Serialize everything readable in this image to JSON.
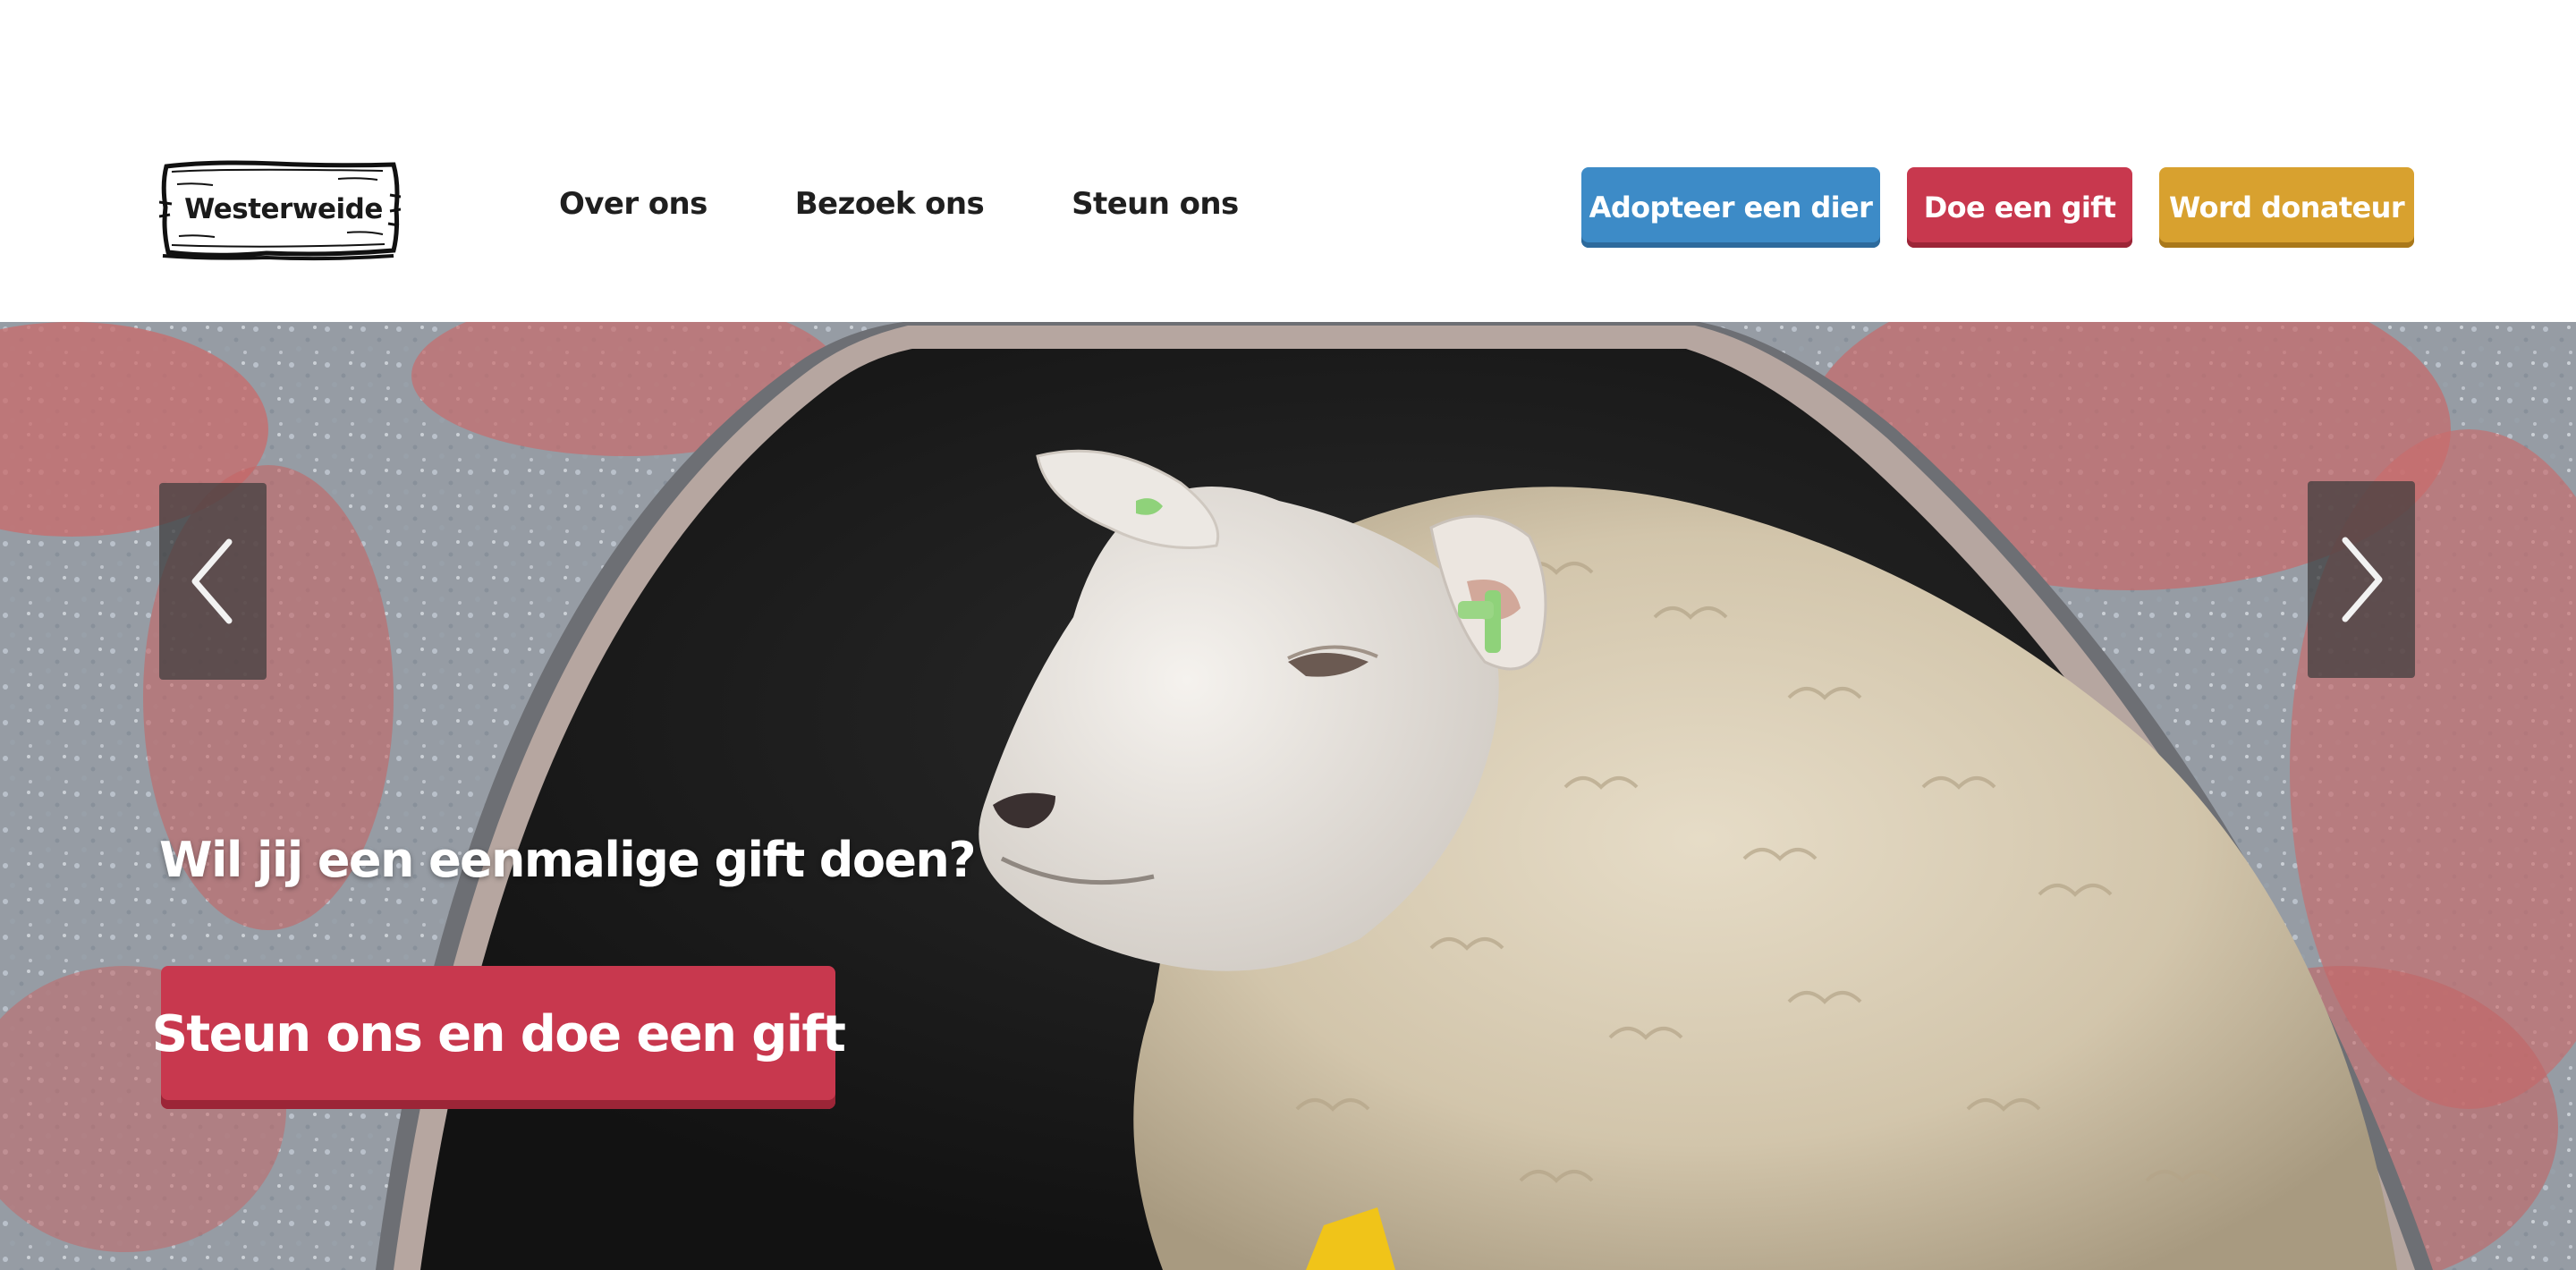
{
  "header": {
    "logo_text": "Westerweide",
    "nav": [
      {
        "label": "Over ons"
      },
      {
        "label": "Bezoek ons"
      },
      {
        "label": "Steun ons"
      }
    ],
    "cta": {
      "adopt_label": "Adopteer een dier",
      "gift_label": "Doe een gift",
      "donor_label": "Word donateur"
    }
  },
  "hero": {
    "heading": "Wil jij een eenmalige gift doen?",
    "button_label": "Steun ons en doe een gift",
    "image_icon": "sheep-in-shelter-photo",
    "prev_icon": "chevron-left-icon",
    "next_icon": "chevron-right-icon"
  },
  "colors": {
    "adopt": "#3d8bc7",
    "gift": "#c8384e",
    "donor": "#d8a12f",
    "text": "#1f1f1f"
  }
}
